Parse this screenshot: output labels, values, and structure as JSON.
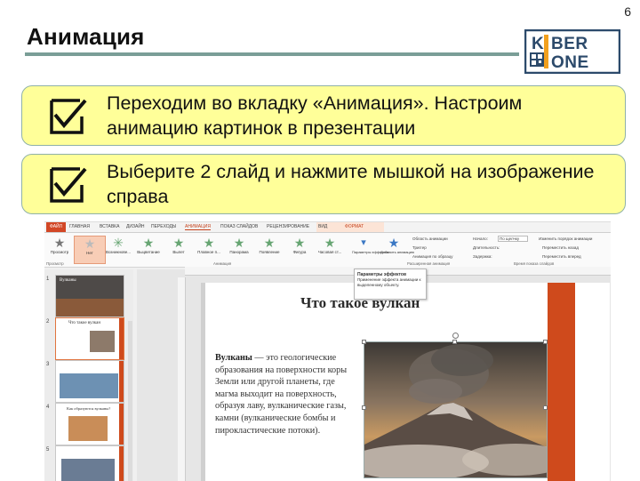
{
  "page_number": "6",
  "title": "Анимация",
  "logo": {
    "line1": "KIBER",
    "line2": "ONE",
    "accent": "#f2a01e",
    "brand": "#2c4a6b"
  },
  "instructions": [
    {
      "text": "Переходим во вкладку «Анимация». Настроим анимацию картинок в презентации"
    },
    {
      "text": "Выберите 2 слайд и нажмите мышкой на изображение справа"
    }
  ],
  "ppt": {
    "tabs": [
      "ФАЙЛ",
      "ГЛАВНАЯ",
      "ВСТАВКА",
      "ДИЗАЙН",
      "ПЕРЕХОДЫ",
      "АНИМАЦИЯ",
      "ПОКАЗ СЛАЙДОВ",
      "РЕЦЕНЗИРОВАНИЕ",
      "ВИД",
      "ФОРМАТ"
    ],
    "ribbon": {
      "preview": "Просмотр",
      "effects": [
        "Нет",
        "Возникнове...",
        "Выцветание",
        "Вылет",
        "Плавное п...",
        "Панорама",
        "Появление",
        "Фигура",
        "Часовая ст..."
      ],
      "effect_params": "Параметры эффектов",
      "add_animation": "Добавить анимацию",
      "animation_area": "Область анимации",
      "trigger": "Триггер",
      "painter": "Анимация по образцу",
      "start_label": "Начало:",
      "start_value": "По щелчку",
      "duration_label": "Длительность:",
      "delay_label": "Задержка:",
      "reorder": "Изменить порядок анимации",
      "move_earlier": "Переместить назад",
      "move_later": "Переместить вперед",
      "groups": [
        "Просмотр",
        "Анимация",
        "Расширенная анимация",
        "Время показа слайдов"
      ]
    },
    "tooltip": {
      "title": "Параметры эффектов",
      "body": "Применение эффекта анимации к выделенному объекту."
    },
    "thumbs": [
      {
        "num": "1",
        "title": "Вулканы"
      },
      {
        "num": "2",
        "title": "Что такое вулкан"
      },
      {
        "num": "3",
        "title": ""
      },
      {
        "num": "4",
        "title": "Как образуются вулканы?"
      },
      {
        "num": "5",
        "title": ""
      }
    ],
    "slide": {
      "title": "Что такое вулкан",
      "body_bold": "Вулканы",
      "body_rest": " — это геологические образования на поверхности коры Земли или другой планеты, где магма выходит на поверхность, образуя лаву, вулканические газы, камни (вулканические бомбы и пирокластические потоки)."
    }
  }
}
